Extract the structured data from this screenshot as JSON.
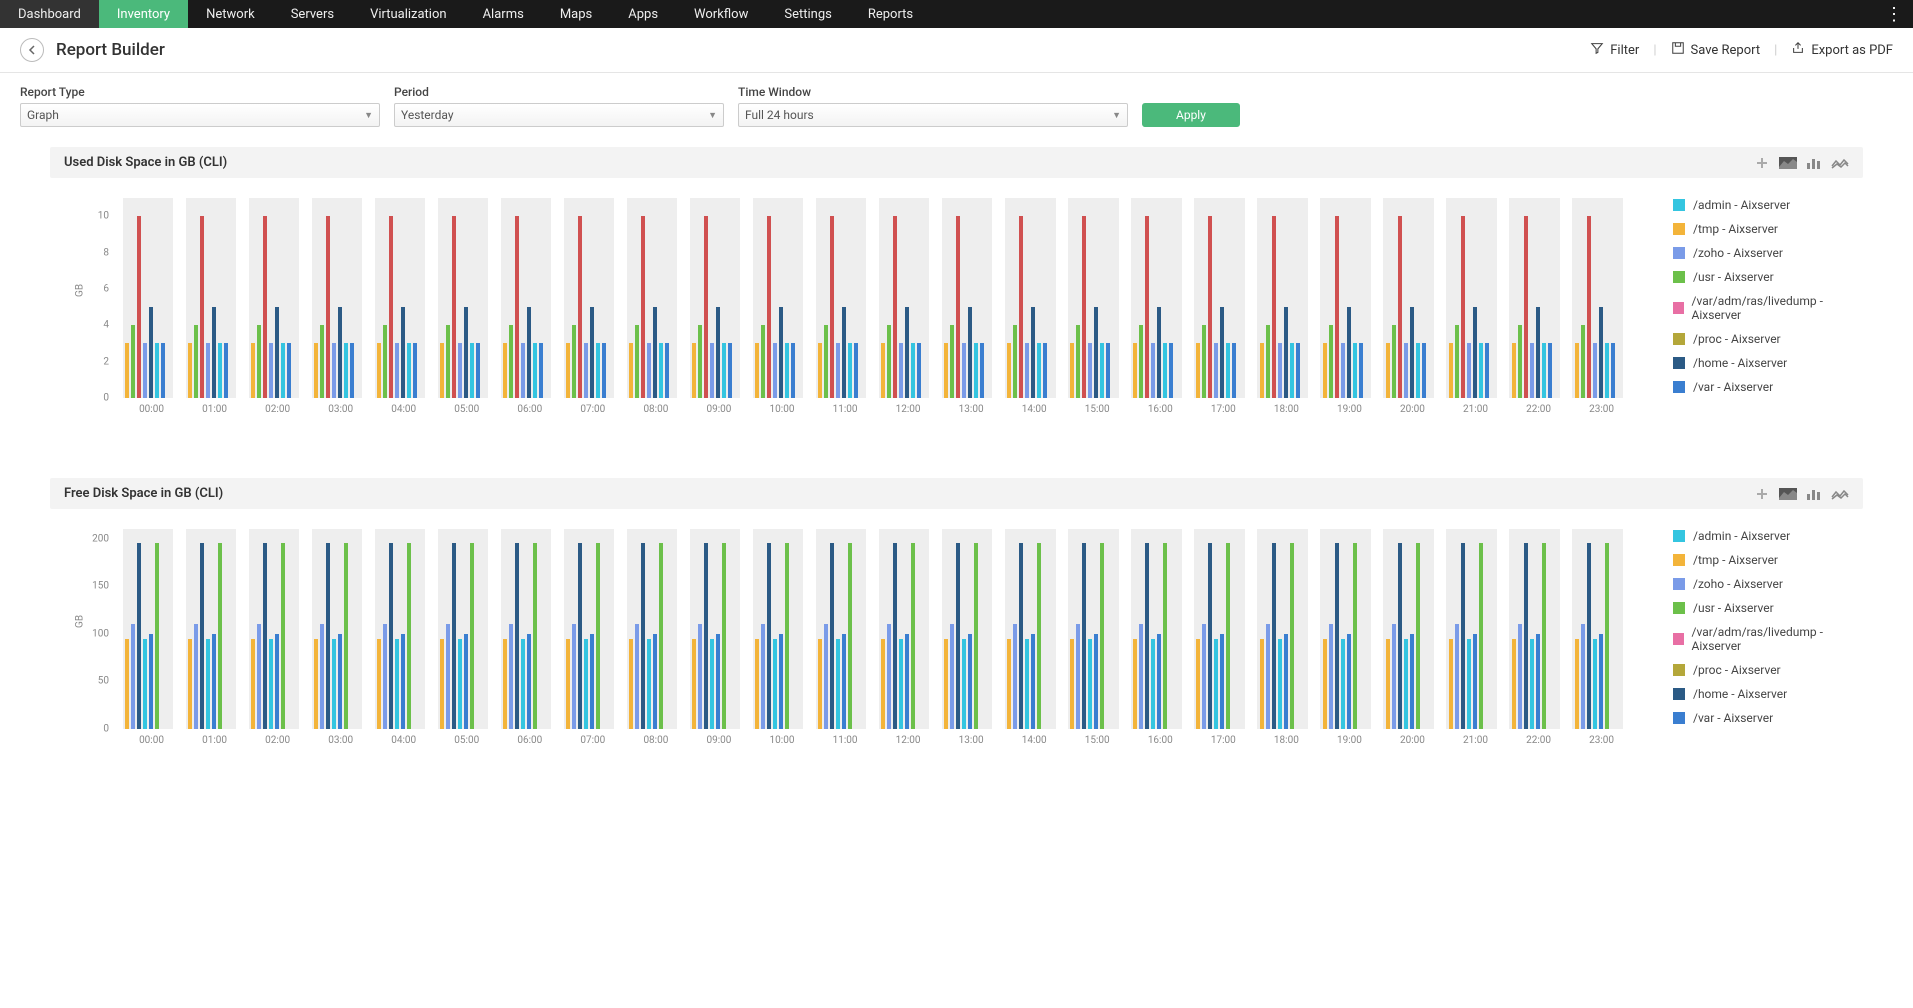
{
  "nav": {
    "items": [
      "Dashboard",
      "Inventory",
      "Network",
      "Servers",
      "Virtualization",
      "Alarms",
      "Maps",
      "Apps",
      "Workflow",
      "Settings",
      "Reports"
    ],
    "active_index": 1
  },
  "header": {
    "title": "Report Builder",
    "actions": {
      "filter": "Filter",
      "save": "Save Report",
      "export": "Export as PDF"
    }
  },
  "filters": {
    "report_type": {
      "label": "Report Type",
      "value": "Graph"
    },
    "period": {
      "label": "Period",
      "value": "Yesterday"
    },
    "time_window": {
      "label": "Time Window",
      "value": "Full 24 hours"
    },
    "apply_label": "Apply"
  },
  "legend_series": [
    {
      "name": "/admin - Aixserver",
      "color": "#34c5e0"
    },
    {
      "name": "/tmp - Aixserver",
      "color": "#f3b43a"
    },
    {
      "name": "/zoho - Aixserver",
      "color": "#7a9be8"
    },
    {
      "name": "/usr - Aixserver",
      "color": "#6cc04a"
    },
    {
      "name": "/var/adm/ras/livedump - Aixserver",
      "color": "#e86fa4"
    },
    {
      "name": "/proc - Aixserver",
      "color": "#b4a73a"
    },
    {
      "name": "/home - Aixserver",
      "color": "#2b5a85"
    },
    {
      "name": "/var - Aixserver",
      "color": "#3a7ed0"
    }
  ],
  "hours": [
    "00:00",
    "01:00",
    "02:00",
    "03:00",
    "04:00",
    "05:00",
    "06:00",
    "07:00",
    "08:00",
    "09:00",
    "10:00",
    "11:00",
    "12:00",
    "13:00",
    "14:00",
    "15:00",
    "16:00",
    "17:00",
    "18:00",
    "19:00",
    "20:00",
    "21:00",
    "22:00",
    "23:00"
  ],
  "charts": [
    {
      "id": "used",
      "title": "Used Disk Space in GB (CLI)"
    },
    {
      "id": "free",
      "title": "Free Disk Space in GB (CLI)"
    }
  ],
  "chart_data": [
    {
      "type": "bar",
      "title": "Used Disk Space in GB (CLI)",
      "xlabel": "",
      "ylabel": "GB",
      "ylim": [
        0,
        11
      ],
      "yticks": [
        0,
        2,
        4,
        6,
        8,
        10
      ],
      "categories": [
        "00:00",
        "01:00",
        "02:00",
        "03:00",
        "04:00",
        "05:00",
        "06:00",
        "07:00",
        "08:00",
        "09:00",
        "10:00",
        "11:00",
        "12:00",
        "13:00",
        "14:00",
        "15:00",
        "16:00",
        "17:00",
        "18:00",
        "19:00",
        "20:00",
        "21:00",
        "22:00",
        "23:00"
      ],
      "series": [
        {
          "name": "/tmp - Aixserver",
          "color": "#f3b43a",
          "value_all_hours": 3.0
        },
        {
          "name": "/usr - Aixserver",
          "color": "#6cc04a",
          "value_all_hours": 4.0
        },
        {
          "name": " - Aixserver",
          "color": "#d05050",
          "value_all_hours": 10.0
        },
        {
          "name": "/zoho - Aixserver",
          "color": "#7a9be8",
          "value_all_hours": 3.0
        },
        {
          "name": "/home - Aixserver",
          "color": "#2b5a85",
          "value_all_hours": 5.0
        },
        {
          "name": "/admin - Aixserver",
          "color": "#34c5e0",
          "value_all_hours": 3.0
        },
        {
          "name": "/var - Aixserver",
          "color": "#3a7ed0",
          "value_all_hours": 3.0
        }
      ],
      "note": "values repeat identically across all 24 hours"
    },
    {
      "type": "bar",
      "title": "Free Disk Space in GB (CLI)",
      "xlabel": "",
      "ylabel": "GB",
      "ylim": [
        0,
        210
      ],
      "yticks": [
        0,
        50,
        100,
        150,
        200
      ],
      "categories": [
        "00:00",
        "01:00",
        "02:00",
        "03:00",
        "04:00",
        "05:00",
        "06:00",
        "07:00",
        "08:00",
        "09:00",
        "10:00",
        "11:00",
        "12:00",
        "13:00",
        "14:00",
        "15:00",
        "16:00",
        "17:00",
        "18:00",
        "19:00",
        "20:00",
        "21:00",
        "22:00",
        "23:00"
      ],
      "series": [
        {
          "name": "/tmp - Aixserver",
          "color": "#f3b43a",
          "value_all_hours": 95
        },
        {
          "name": "/zoho - Aixserver",
          "color": "#7a9be8",
          "value_all_hours": 110
        },
        {
          "name": "/home - Aixserver",
          "color": "#2b5a85",
          "value_all_hours": 195
        },
        {
          "name": "/admin - Aixserver",
          "color": "#34c5e0",
          "value_all_hours": 95
        },
        {
          "name": "/var - Aixserver",
          "color": "#3a7ed0",
          "value_all_hours": 100
        },
        {
          "name": "/usr - Aixserver",
          "color": "#6cc04a",
          "value_all_hours": 195
        }
      ],
      "note": "values repeat identically across all 24 hours"
    }
  ]
}
